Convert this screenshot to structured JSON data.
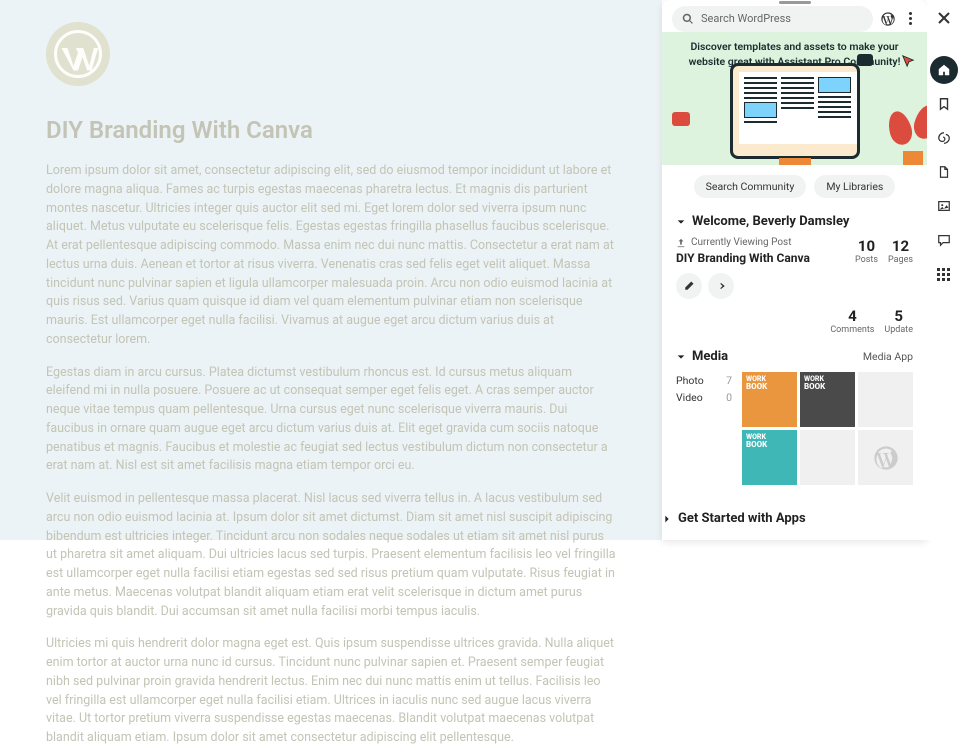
{
  "search": {
    "placeholder": "Search WordPress"
  },
  "hero": {
    "text": "Discover templates and assets to make your website great with Assistant Pro Community!"
  },
  "pills": {
    "community": "Search Community",
    "libraries": "My Libraries"
  },
  "welcome": {
    "heading": "Welcome, Beverly Damsley",
    "viewing_label": "Currently Viewing Post",
    "current_post": "DIY Branding With Canva",
    "stats": {
      "posts": {
        "n": "10",
        "l": "Posts"
      },
      "pages": {
        "n": "12",
        "l": "Pages"
      },
      "comments": {
        "n": "4",
        "l": "Comments"
      },
      "updates": {
        "n": "5",
        "l": "Update"
      }
    }
  },
  "media": {
    "heading": "Media",
    "link": "Media App",
    "filters": {
      "photo": {
        "label": "Photo",
        "count": "7"
      },
      "video": {
        "label": "Video",
        "count": "0"
      }
    },
    "thumb_text": {
      "line1": "WORK",
      "line2": "BOOK"
    }
  },
  "apps": {
    "heading": "Get Started with Apps"
  },
  "post": {
    "title": "DIY Branding With Canva",
    "p1": "Lorem ipsum dolor sit amet, consectetur adipiscing elit, sed do eiusmod tempor incididunt ut labore et dolore magna aliqua. Fames ac turpis egestas maecenas pharetra lectus. Et magnis dis parturient montes nascetur. Ultricies integer quis auctor elit sed mi. Eget lorem dolor sed viverra ipsum nunc aliquet. Metus vulputate eu scelerisque felis. Egestas egestas fringilla phasellus faucibus scelerisque. At erat pellentesque adipiscing commodo. Massa enim nec dui nunc mattis. Consectetur a erat nam at lectus urna duis. Aenean et tortor at risus viverra. Venenatis cras sed felis eget velit aliquet. Massa tincidunt nunc pulvinar sapien et ligula ullamcorper malesuada proin. Arcu non odio euismod lacinia at quis risus sed. Varius quam quisque id diam vel quam elementum pulvinar etiam non scelerisque mauris. Est ullamcorper eget nulla facilisi. Vivamus at augue eget arcu dictum varius duis at consectetur lorem.",
    "p2": "Egestas diam in arcu cursus. Platea dictumst vestibulum rhoncus est. Id cursus metus aliquam eleifend mi in nulla posuere. Posuere ac ut consequat semper eget felis eget. A cras semper auctor neque vitae tempus quam pellentesque. Urna cursus eget nunc scelerisque viverra mauris. Dui faucibus in ornare quam augue eget arcu dictum varius duis at. Elit eget gravida cum sociis natoque penatibus et magnis. Faucibus et molestie ac feugiat sed lectus vestibulum dictum non consectetur a erat nam at. Nisl est sit amet facilisis magna etiam tempor orci eu.",
    "p3": "Velit euismod in pellentesque massa placerat. Nisl lacus sed viverra tellus in. A lacus vestibulum sed arcu non odio euismod lacinia at. Ipsum dolor sit amet dictumst. Diam sit amet nisl suscipit adipiscing bibendum est ultricies integer. Tincidunt arcu non sodales neque sodales ut etiam sit amet nisl purus ut pharetra sit amet aliquam. Dui ultricies lacus sed turpis. Praesent elementum facilisis leo vel fringilla est ullamcorper eget nulla facilisi etiam egestas sed sed risus pretium quam vulputate. Risus feugiat in ante metus. Maecenas volutpat blandit aliquam etiam erat velit scelerisque in dictum amet purus gravida quis blandit. Dui accumsan sit amet nulla facilisi morbi tempus iaculis.",
    "p4": "Ultricies mi quis hendrerit dolor magna eget est. Quis ipsum suspendisse ultrices gravida. Nulla aliquet enim tortor at auctor urna nunc id cursus. Tincidunt nunc pulvinar sapien et. Praesent semper feugiat nibh sed pulvinar proin gravida hendrerit lectus. Enim nec dui nunc mattis enim ut tellus. Facilisis leo vel fringilla est ullamcorper eget nulla facilisi etiam. Ultrices in iaculis nunc sed augue lacus viverra vitae. Ut tortor pretium viverra suspendisse egestas maecenas. Blandit volutpat maecenas volutpat blandit aliquam etiam. Ipsum dolor sit amet consectetur adipiscing elit pellentesque."
  }
}
